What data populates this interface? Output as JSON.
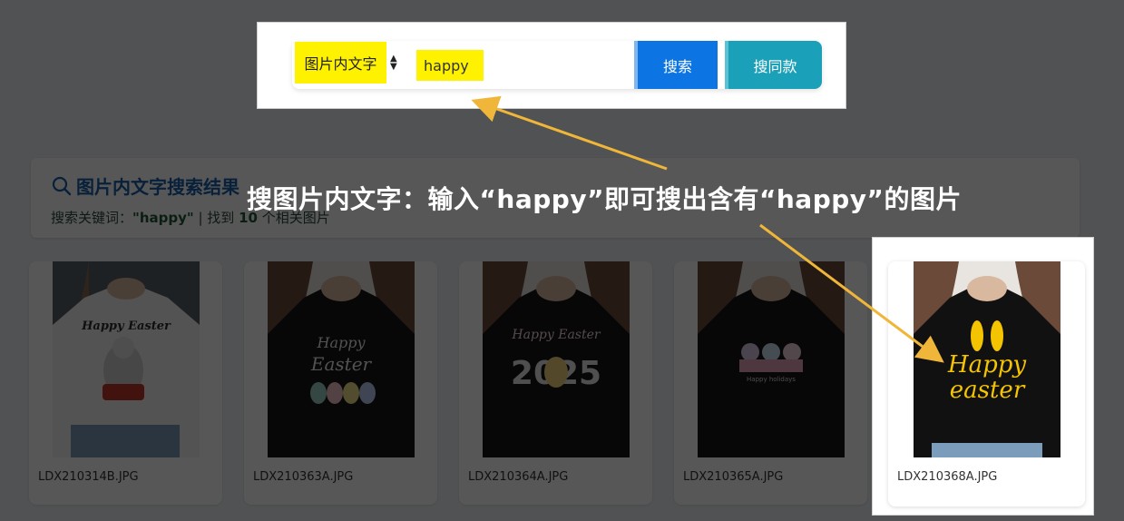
{
  "search": {
    "type_label": "图片内文字",
    "query": "happy",
    "search_button": "搜索",
    "same_style_button": "搜同款"
  },
  "results": {
    "title": "图片内文字搜索结果",
    "keyword_prefix": "搜索关键词：",
    "keyword": "\"happy\"",
    "found_prefix": " | 找到 ",
    "count": "10",
    "found_suffix": " 个相关图片"
  },
  "cards": [
    {
      "filename": "LDX210314B.JPG",
      "shirt": "white",
      "print": "Happy Easter"
    },
    {
      "filename": "LDX210363A.JPG",
      "shirt": "black",
      "print": "Happy Easter"
    },
    {
      "filename": "LDX210364A.JPG",
      "shirt": "black",
      "print": "Happy Easter 2025"
    },
    {
      "filename": "LDX210365A.JPG",
      "shirt": "black",
      "print": "Happy holidays"
    },
    {
      "filename": "LDX210368A.JPG",
      "shirt": "black",
      "print": "Happy easter"
    }
  ],
  "annotation": "搜图片内文字：输入“happy”即可搜出含有“happy”的图片",
  "colors": {
    "highlight": "#fff200",
    "search_button": "#0d74e3",
    "same_button": "#1aa0b8",
    "arrow": "#f0b63a",
    "title": "#1a5fa8"
  }
}
